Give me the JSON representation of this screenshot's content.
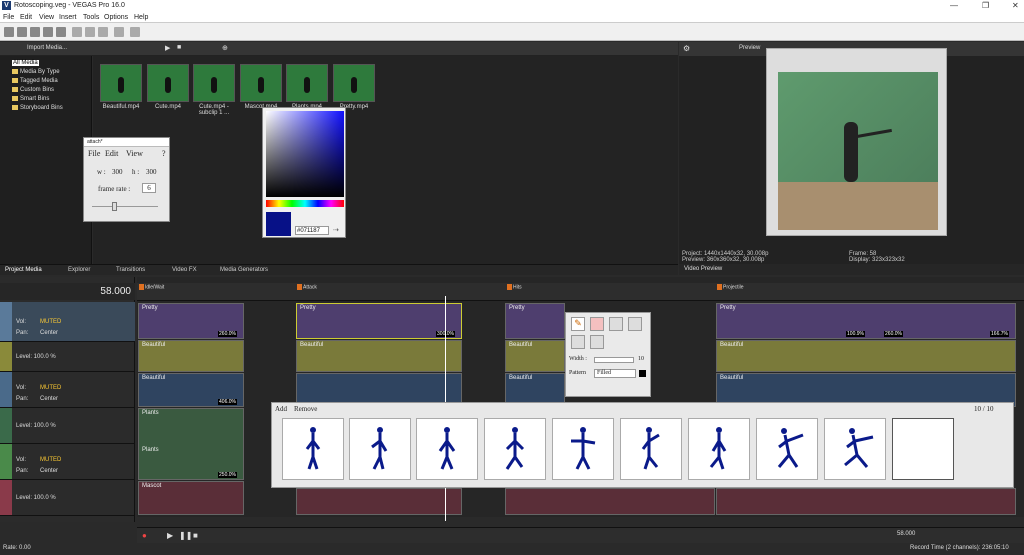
{
  "window": {
    "title": "Rotoscoping.veg - VEGAS Pro 16.0",
    "logo": "V"
  },
  "menu": [
    "File",
    "Edit",
    "View",
    "Insert",
    "Tools",
    "Options",
    "Help"
  ],
  "media_toolbar": {
    "import": "Import Media..."
  },
  "tree": [
    "All Media",
    "Media By Type",
    "Tagged Media",
    "Custom Bins",
    "Smart Bins",
    "Storyboard Bins"
  ],
  "media_items": [
    "Beautiful.mp4",
    "Cute.mp4",
    "Cute.mp4 - subclip 1 ...",
    "Mascot.mp4",
    "Plants.mp4",
    "Pretty.mp4"
  ],
  "bottom_tabs": [
    "Project Media",
    "Explorer",
    "Transitions",
    "Video FX",
    "Media Generators"
  ],
  "preview": {
    "tab_label": "Preview",
    "tab": "Video Preview",
    "project": "Project:  1440x1440x32, 30.008p",
    "preview": "Preview:  360x360x32, 30.008p",
    "frame": "Frame:    58",
    "display": "Display:  323x323x32"
  },
  "palette_window": {
    "title": "attach*",
    "menu": [
      "File",
      "Edit",
      "View"
    ],
    "help": "?",
    "w_label": "w :",
    "w": "300",
    "h_label": "h :",
    "h": "300",
    "fr_label": "frame rate :",
    "frame_rate": "6"
  },
  "color_picker": {
    "hex": "#071187",
    "color": "#071187"
  },
  "draw_tool": {
    "width_label": "Width :",
    "width": "10",
    "pattern_label": "Pattern",
    "pattern": "Filled"
  },
  "frames_panel": {
    "add": "Add",
    "remove": "Remove",
    "counter": "10 / 10"
  },
  "timeline": {
    "timecode": "58.000",
    "markers": [
      "Idle/Wait",
      "Attack",
      "Hits",
      "Projectile"
    ],
    "pct": [
      "260.0%",
      "300.0%",
      "100.9%",
      "260.0%",
      "166.7%",
      "406.0%",
      "250.0%",
      "300.0%"
    ],
    "tracks": [
      {
        "vol_label": "Vol:",
        "vol": "MUTED",
        "pan_label": "Pan:",
        "pan": "Center"
      },
      {
        "level": "Level: 100.0 %"
      },
      {
        "vol_label": "Vol:",
        "vol": "MUTED",
        "pan_label": "Pan:",
        "pan": "Center"
      },
      {
        "level": "Level: 100.0 %"
      },
      {
        "vol_label": "Vol:",
        "vol": "MUTED",
        "pan_label": "Pan:",
        "pan": "Center"
      },
      {
        "level": "Level: 100.0 %"
      }
    ],
    "event_names": [
      "Pretty",
      "Beautiful",
      "Plants",
      "Mascot"
    ]
  },
  "status": {
    "rate": "Rate: 0.00",
    "time": "58.000",
    "record": "Record Time (2 channels): 236:05:10"
  }
}
